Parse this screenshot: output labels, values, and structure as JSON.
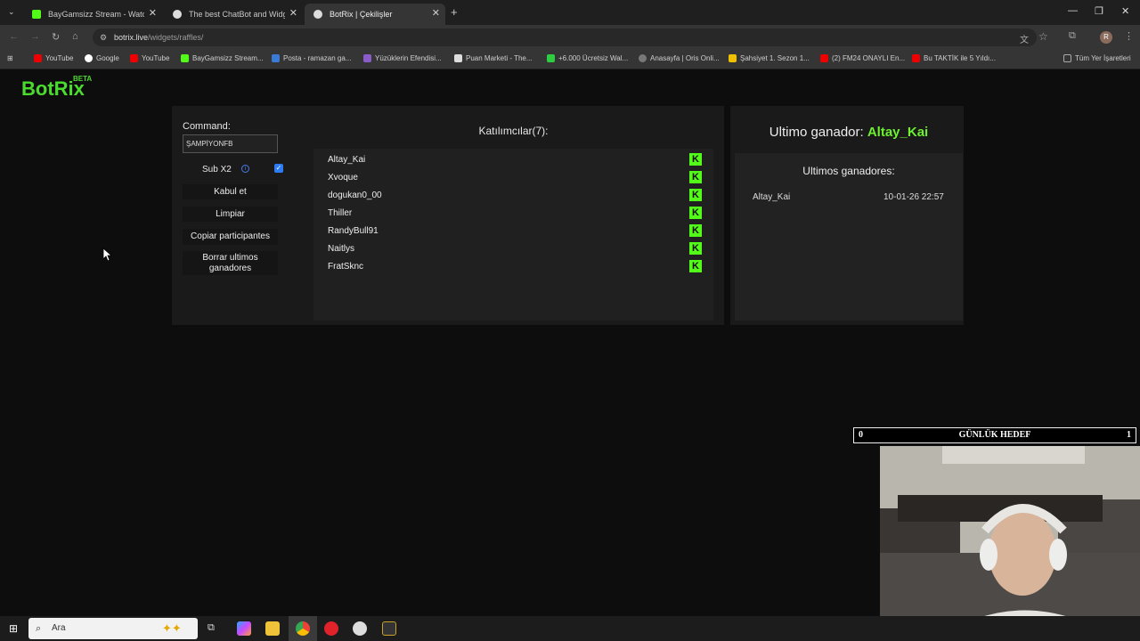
{
  "browser": {
    "tabs": [
      {
        "title": "BayGamsizz Stream - Watch Live",
        "icon": "kick-icon"
      },
      {
        "title": "The best ChatBot and Widgets",
        "icon": "botrix-icon"
      },
      {
        "title": "BotRix | Çekilişler",
        "icon": "botrix-icon",
        "active": true
      }
    ],
    "url_host": "botrix.live",
    "url_path": "/widgets/raffles/",
    "bookmarks": [
      "YouTube",
      "Google",
      "YouTube",
      "BayGamsizz Stream...",
      "Posta - ramazan ga...",
      "Yüzüklerin Efendisi...",
      "Puan Marketi - The...",
      "+6.000 Ücretsiz Wal...",
      "Anasayfa | Oris Onli...",
      "Şahsiyet 1. Sezon 1...",
      "(2) FM24 ONAYLI En...",
      "Bu TAKTİK ile 5 Yıldı..."
    ],
    "all_bookmarks": "Tüm Yer İşaretleri",
    "profile_initial": "R"
  },
  "app": {
    "logo": "BotRix",
    "logo_badge": "BETA",
    "accent": "#4bdb2f"
  },
  "controls": {
    "command_label": "Command:",
    "command_value": "ŞAMPİYONFB",
    "sub_x2_label": "Sub X2",
    "sub_x2_checked": true,
    "accept_label": "Kabul et",
    "clear_label": "Limpiar",
    "copy_label": "Copiar participantes",
    "delete_winners_label": "Borrar ultimos ganadores"
  },
  "participants": {
    "header": "Katılımcılar(7):",
    "items": [
      "Altay_Kai",
      "Xvoque",
      "dogukan0_00",
      "Thiller",
      "RandyBull91",
      "Naitlys",
      "FratSknc"
    ],
    "platform_icon": "kick-icon",
    "platform_color": "#53fc18"
  },
  "winner": {
    "label": "Ultimo ganador:",
    "name": "Altay_Kai",
    "history_header": "Ultimos ganadores:",
    "history": [
      {
        "name": "Altay_Kai",
        "time": "10-01-26 22:57"
      }
    ]
  },
  "overlay": {
    "goal_current": "0",
    "goal_label": "GÜNLÜK HEDEF",
    "goal_target": "1",
    "goal_progress": 0
  },
  "taskbar": {
    "search_placeholder": "Ara"
  }
}
